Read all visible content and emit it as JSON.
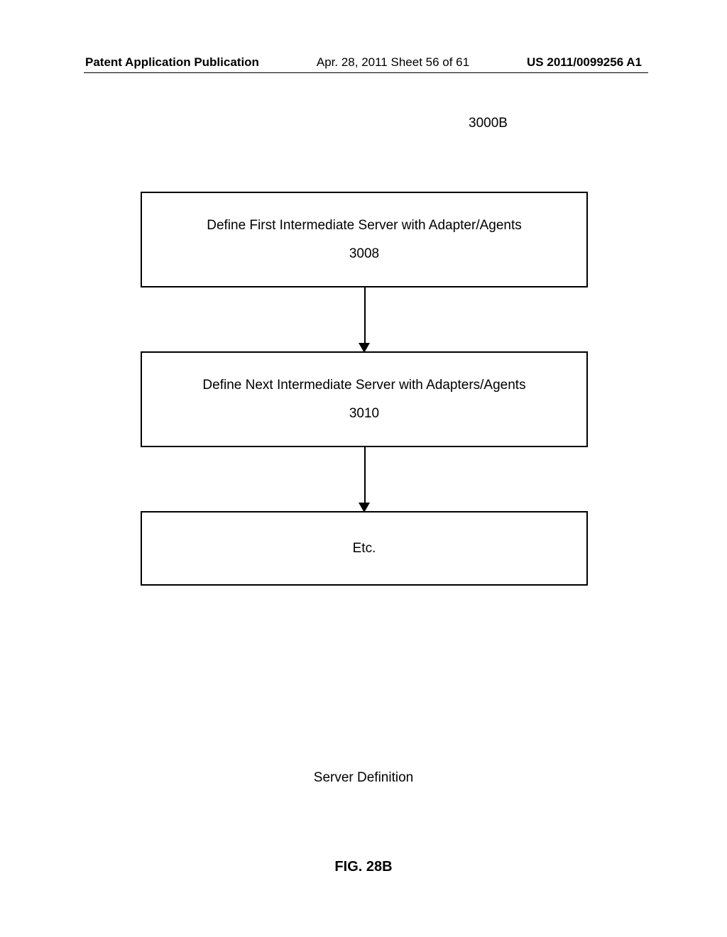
{
  "header": {
    "left": "Patent Application Publication",
    "center": "Apr. 28, 2011  Sheet 56 of 61",
    "right": "US 2011/0099256 A1"
  },
  "figure_label": "3000B",
  "boxes": [
    {
      "title": "Define First Intermediate Server with Adapter/Agents",
      "number": "3008"
    },
    {
      "title": "Define Next Intermediate Server with Adapters/Agents",
      "number": "3010"
    },
    {
      "title": "Etc.",
      "number": ""
    }
  ],
  "caption": "Server Definition",
  "figure_number": "FIG. 28B"
}
